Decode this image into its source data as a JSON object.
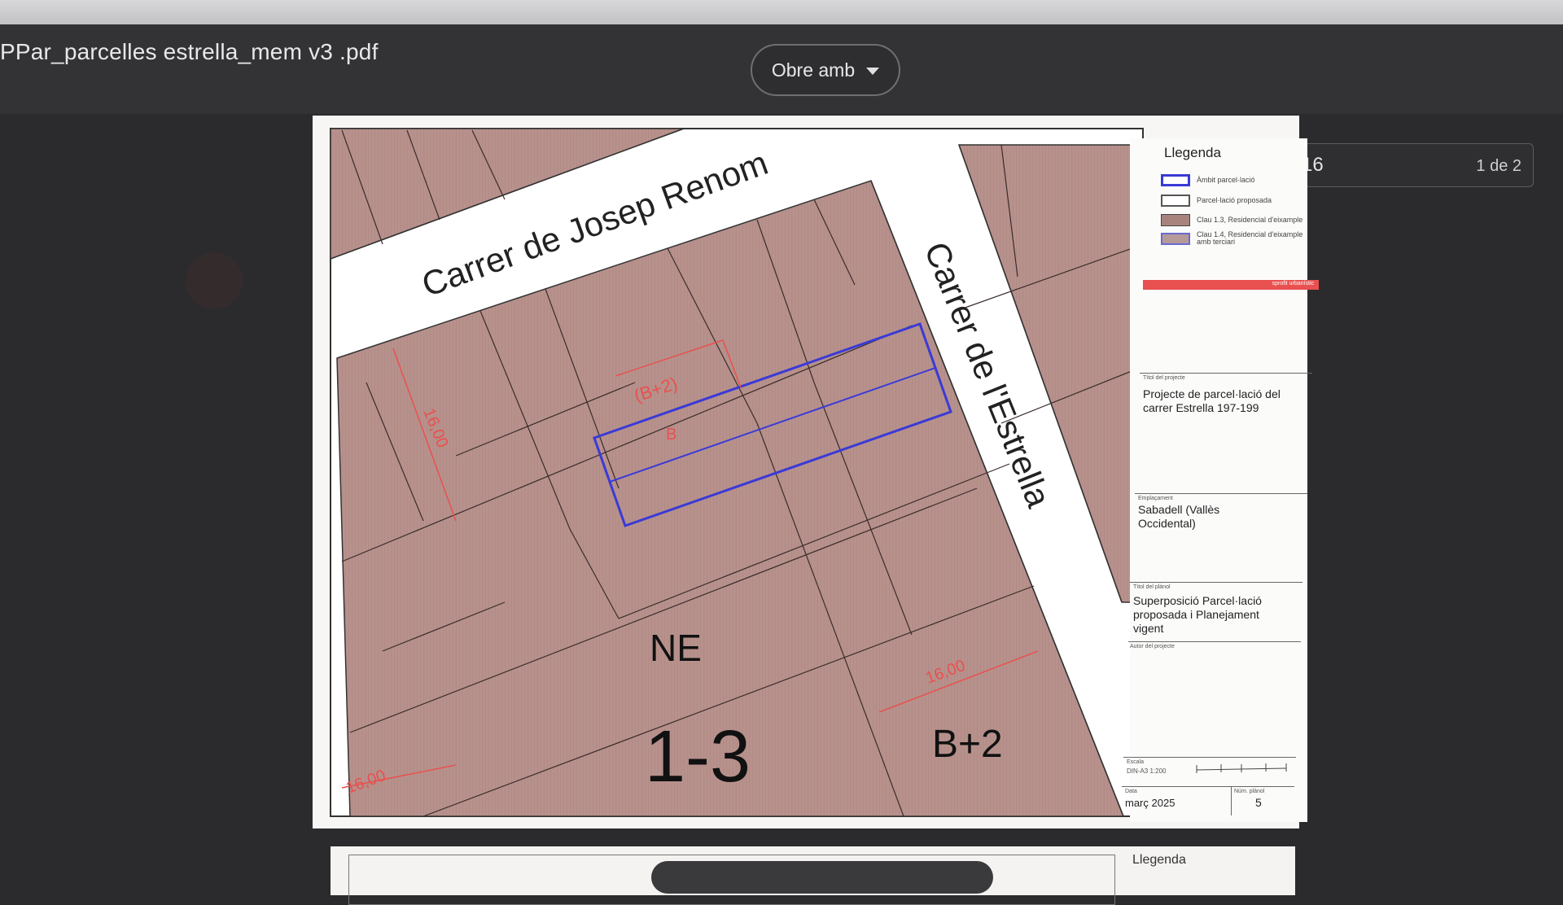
{
  "toolbar": {
    "filename": "PPar_parcelles estrella_mem v3 .pdf",
    "open_with_label": "Obre amb",
    "page_current": "16",
    "page_total": "1 de 2"
  },
  "colors": {
    "parcel_fill": "#b8918c",
    "boundary_blue": "#3a3ad6",
    "dimension_red": "#e8514f"
  },
  "map": {
    "street_1": "Carrer de Josep Renom",
    "street_2": "Carrer de l'Estrella",
    "zone_label": "NE",
    "code_label": "1-3",
    "height_label": "B+2",
    "plot_height_label": "(B+2)",
    "plot_letter": "B",
    "dim_1": "16,00",
    "dim_2": "16,00",
    "dim_3": "16,00"
  },
  "legend": {
    "title": "Llegenda",
    "items": [
      "Àmbit parcel·lació",
      "Parcel·lació proposada",
      "Clau 1.3, Residencial d'eixample",
      "Clau 1.4, Residencial d'eixample amb terciari"
    ],
    "red_bar_text": "sprofit urbanístic"
  },
  "titleblock": {
    "project_label": "Títol del projecte",
    "project_title": "Projecte de parcel·lació del carrer Estrella 197-199",
    "location_label": "Emplaçament",
    "location": "Sabadell (Vallès Occidental)",
    "plan_label": "Títol del plànol",
    "plan_title": "Superposició Parcel·lació proposada i Planejament vigent",
    "author_label": "Autor del projecte",
    "scale_label": "Escala",
    "scale": "DIN-A3  1:200",
    "date_label": "Data",
    "date": "març 2025",
    "sheet_label": "Núm. plànol",
    "sheet": "5"
  },
  "page2": {
    "legend_title": "Llegenda"
  }
}
